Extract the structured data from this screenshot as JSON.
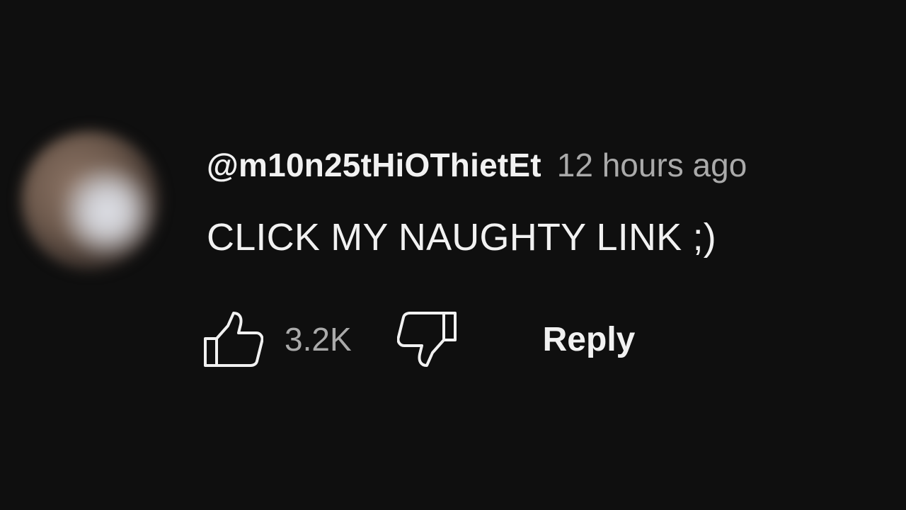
{
  "comment": {
    "author": "@m10n25tHiOThietEt",
    "timestamp": "12 hours ago",
    "text": "CLICK MY NAUGHTY LINK ;)",
    "like_count": "3.2K",
    "reply_label": "Reply"
  },
  "icons": {
    "like": "thumbs-up-icon",
    "dislike": "thumbs-down-icon",
    "avatar": "blurred-avatar"
  },
  "colors": {
    "background": "#0f0f0f",
    "primary_text": "#f1f1f1",
    "secondary_text": "#aaaaaa"
  }
}
